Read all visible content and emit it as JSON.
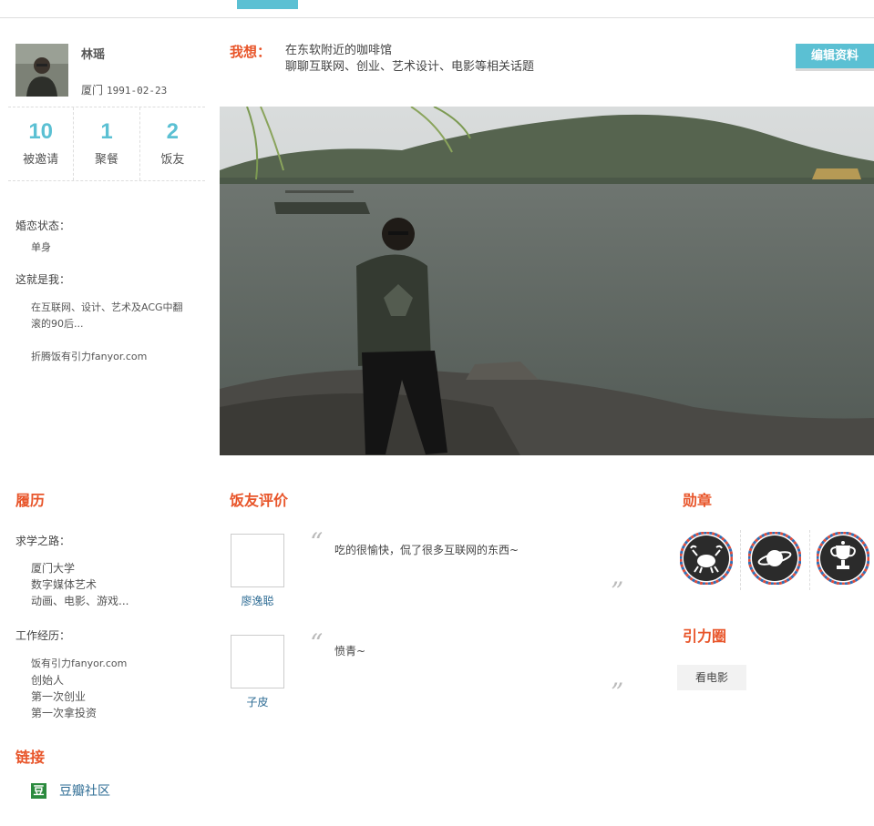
{
  "profile": {
    "name": "林瑶",
    "city": "厦门",
    "birthday": "1991-02-23",
    "stats": [
      {
        "value": "10",
        "label": "被邀请"
      },
      {
        "value": "1",
        "label": "聚餐"
      },
      {
        "value": "2",
        "label": "饭友"
      }
    ],
    "marital_label": "婚恋状态：",
    "marital_value": "单身",
    "about_label": "这就是我：",
    "about_line1": "在互联网、设计、艺术及ACG中翻",
    "about_line2": "滚的90后...",
    "about_line3": "折腾饭有引力fanyor.com"
  },
  "header": {
    "wish_label": "我想：",
    "wish_line1": "在东软附近的咖啡馆",
    "wish_line2": "聊聊互联网、创业、艺术设计、电影等相关话题",
    "edit_button": "编辑资料"
  },
  "resume": {
    "title": "履历",
    "study_label": "求学之路：",
    "study": [
      "厦门大学",
      "数字媒体艺术",
      "动画、电影、游戏..."
    ],
    "work_label": "工作经历：",
    "work": [
      "饭有引力fanyor.com",
      "创始人",
      "第一次创业",
      "第一次拿投资"
    ]
  },
  "links": {
    "title": "链接",
    "items": [
      {
        "label": "豆瓣社区",
        "icon": "douban-icon"
      }
    ]
  },
  "reviews": {
    "title": "饭友评价",
    "items": [
      {
        "name": "廖逸聪",
        "text": "吃的很愉快，侃了很多互联网的东西~"
      },
      {
        "name": "子皮",
        "text": "愤青~"
      }
    ]
  },
  "medals": {
    "title": "勋章",
    "items": [
      {
        "icon": "crab-icon"
      },
      {
        "icon": "planet-icon"
      },
      {
        "icon": "trophy-icon"
      }
    ]
  },
  "circle": {
    "title": "引力圈",
    "tags": [
      "看电影"
    ]
  },
  "colors": {
    "accent": "#5bc0d3",
    "heading": "#e8552a",
    "link": "#2e6c94"
  }
}
